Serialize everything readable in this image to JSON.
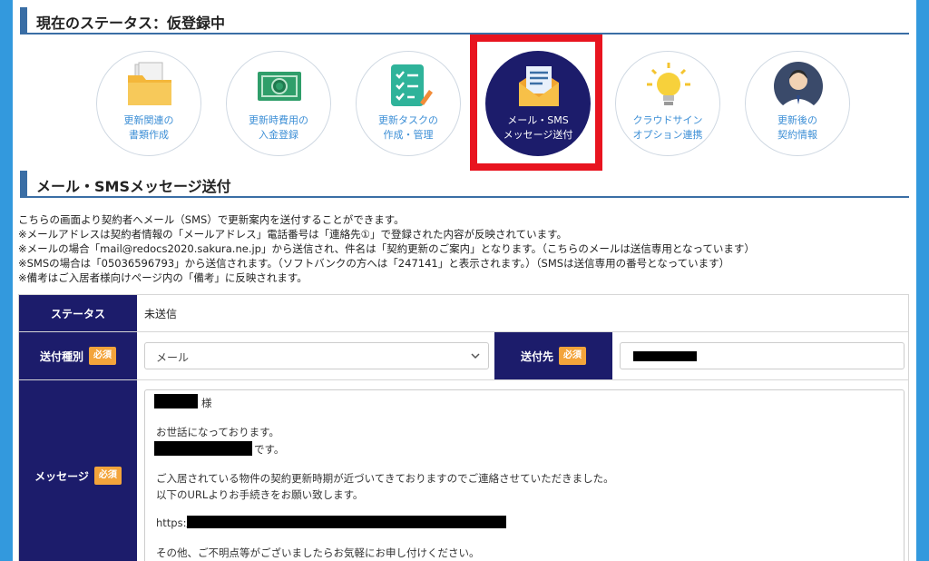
{
  "status_header": {
    "title": "現在のステータス：仮登録中"
  },
  "steps": [
    {
      "label": "更新関連の\n書類作成",
      "icon": "folder-documents-icon",
      "active": false
    },
    {
      "label": "更新時費用の\n入金登録",
      "icon": "money-bill-icon",
      "active": false
    },
    {
      "label": "更新タスクの\n作成・管理",
      "icon": "task-checklist-icon",
      "active": false
    },
    {
      "label": "メール・SMS\nメッセージ送付",
      "icon": "mail-envelope-icon",
      "active": true
    },
    {
      "label": "クラウドサイン\nオプション連携",
      "icon": "lightbulb-icon",
      "active": false
    },
    {
      "label": "更新後の\n契約情報",
      "icon": "person-avatar-icon",
      "active": false
    }
  ],
  "section_header": {
    "title": "メール・SMSメッセージ送付"
  },
  "intro_lines": [
    "こちらの画面より契約者へメール（SMS）で更新案内を送付することができます。",
    "※メールアドレスは契約者情報の「メールアドレス」電話番号は「連絡先①」で登録された内容が反映されています。",
    "※メールの場合「mail@redocs2020.sakura.ne.jp」から送信され、件名は「契約更新のご案内」となります。（こちらのメールは送信専用となっています）",
    "※SMSの場合は「05036596793」から送信されます。（ソフトバンクの方へは「247141」と表示されます。）（SMSは送信専用の番号となっています）",
    "※備考はご入居者様向けページ内の「備考」に反映されます。"
  ],
  "form": {
    "status_label": "ステータス",
    "status_value": "未送信",
    "send_type_label": "送付種別",
    "send_type_value": "メール",
    "send_to_label": "送付先",
    "message_label": "メッセージ",
    "required_badge": "必須",
    "message_lines": {
      "salutation": "様",
      "greeting": "お世話になっております。",
      "desu": "です。",
      "body1": "ご入居されている物件の契約更新時期が近づいてきておりますのでご連絡させていただきました。",
      "body2": "以下のURLよりお手続きをお願い致します。",
      "url_prefix": "https://",
      "closing": "その他、ご不明点等がございましたらお気軽にお申し付けください。"
    }
  },
  "colors": {
    "page_bg": "#3399dd",
    "navy": "#1c1c6b",
    "accent_blue": "#3a6ea5",
    "required_orange": "#f3a43b",
    "highlight_red": "#e8141f",
    "step_label_blue": "#3d8fd6"
  }
}
